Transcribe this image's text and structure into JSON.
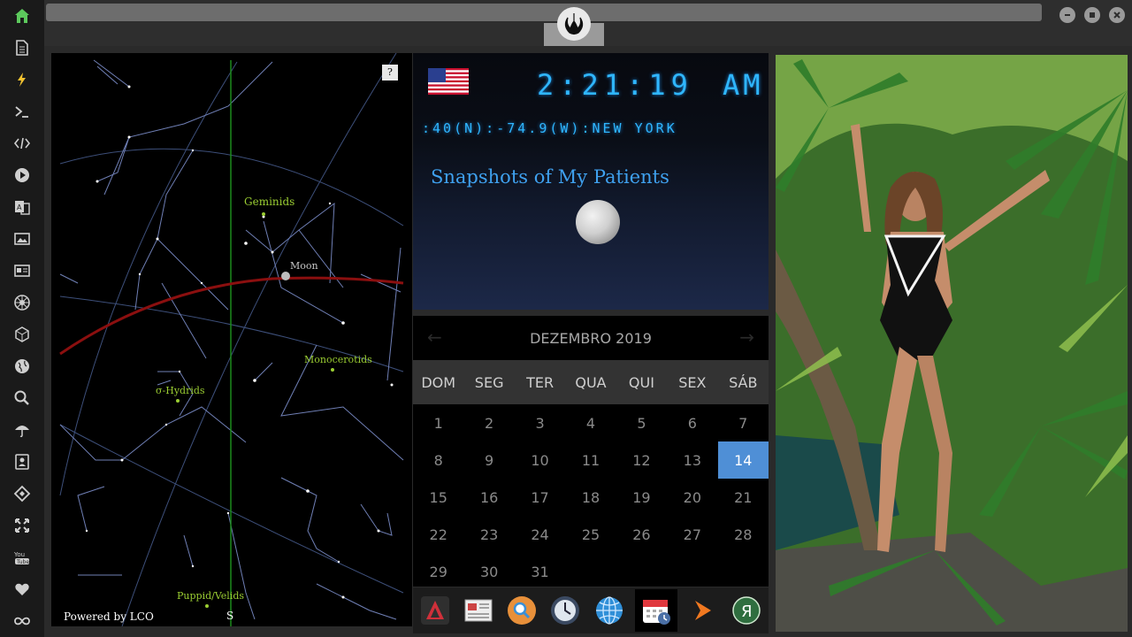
{
  "sidebar": {
    "items": [
      {
        "icon": "home-icon",
        "color": "#5cc95c"
      },
      {
        "icon": "document-icon"
      },
      {
        "icon": "lightning-icon",
        "color": "#f2c230"
      },
      {
        "icon": "terminal-icon"
      },
      {
        "icon": "code-icon"
      },
      {
        "icon": "play-icon"
      },
      {
        "icon": "translate-icon"
      },
      {
        "icon": "image-icon"
      },
      {
        "icon": "newspaper-icon"
      },
      {
        "icon": "empire-icon"
      },
      {
        "icon": "cube-icon"
      },
      {
        "icon": "globe-icon"
      },
      {
        "icon": "search-icon"
      },
      {
        "icon": "umbrella-icon"
      },
      {
        "icon": "contacts-icon"
      },
      {
        "icon": "tag-icon"
      },
      {
        "icon": "fullscreen-icon"
      },
      {
        "icon": "youtube-icon"
      },
      {
        "icon": "heart-icon"
      },
      {
        "icon": "infinity-icon"
      }
    ]
  },
  "skymap": {
    "help_label": "?",
    "powered_by": "Powered by LCO",
    "labels": {
      "geminids": "Geminids",
      "moon": "Moon",
      "monocerotids": "Monocerotids",
      "sigma_hydrids": "σ-Hydrids",
      "puppid_velids": "Puppid/Velids",
      "south": "S"
    }
  },
  "clock": {
    "time": "2:21:19",
    "ampm": "AM",
    "location": ":40(N):-74.9(W):NEW YORK",
    "title": "Snapshots of My Patients",
    "accent_color": "#2fb6ff"
  },
  "calendar": {
    "month_label": "DEZEMBRO 2019",
    "prev_arrow": "←",
    "next_arrow": "→",
    "day_names": [
      "DOM",
      "SEG",
      "TER",
      "QUA",
      "QUI",
      "SEX",
      "SÁB"
    ],
    "days": [
      "1",
      "2",
      "3",
      "4",
      "5",
      "6",
      "7",
      "8",
      "9",
      "10",
      "11",
      "12",
      "13",
      "14",
      "15",
      "16",
      "17",
      "18",
      "19",
      "20",
      "21",
      "22",
      "23",
      "24",
      "25",
      "26",
      "27",
      "28",
      "29",
      "30",
      "31"
    ],
    "today": "14",
    "today_color": "#4f8fd6"
  },
  "dock": {
    "items": [
      {
        "icon": "arch-icon"
      },
      {
        "icon": "news-reader-icon"
      },
      {
        "icon": "search-app-icon"
      },
      {
        "icon": "clock-app-icon"
      },
      {
        "icon": "globe-app-icon"
      },
      {
        "icon": "calendar-app-icon",
        "active": true
      },
      {
        "icon": "arrow-app-icon"
      },
      {
        "icon": "yandex-app-icon",
        "label": "Я"
      }
    ]
  }
}
